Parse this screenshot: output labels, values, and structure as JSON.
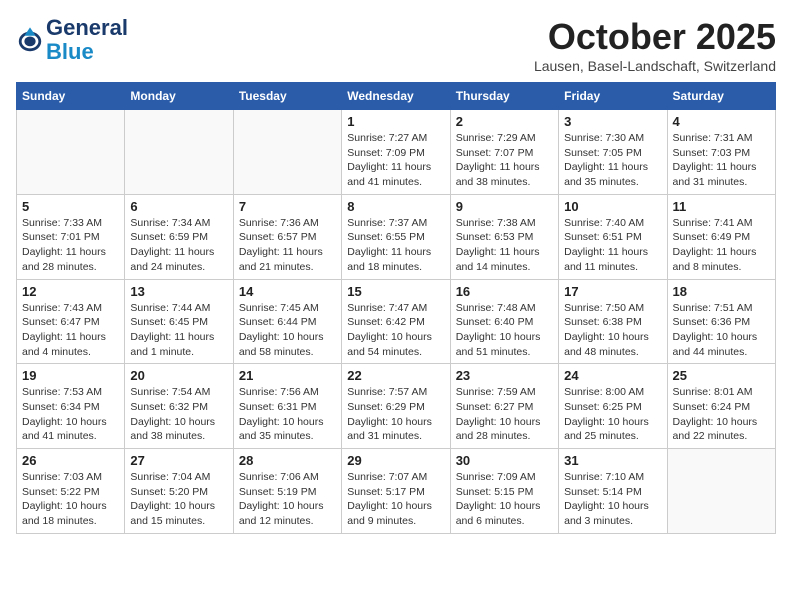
{
  "header": {
    "logo_line1": "General",
    "logo_line2": "Blue",
    "month": "October 2025",
    "location": "Lausen, Basel-Landschaft, Switzerland"
  },
  "weekdays": [
    "Sunday",
    "Monday",
    "Tuesday",
    "Wednesday",
    "Thursday",
    "Friday",
    "Saturday"
  ],
  "weeks": [
    [
      {
        "day": "",
        "info": ""
      },
      {
        "day": "",
        "info": ""
      },
      {
        "day": "",
        "info": ""
      },
      {
        "day": "1",
        "info": "Sunrise: 7:27 AM\nSunset: 7:09 PM\nDaylight: 11 hours and 41 minutes."
      },
      {
        "day": "2",
        "info": "Sunrise: 7:29 AM\nSunset: 7:07 PM\nDaylight: 11 hours and 38 minutes."
      },
      {
        "day": "3",
        "info": "Sunrise: 7:30 AM\nSunset: 7:05 PM\nDaylight: 11 hours and 35 minutes."
      },
      {
        "day": "4",
        "info": "Sunrise: 7:31 AM\nSunset: 7:03 PM\nDaylight: 11 hours and 31 minutes."
      }
    ],
    [
      {
        "day": "5",
        "info": "Sunrise: 7:33 AM\nSunset: 7:01 PM\nDaylight: 11 hours and 28 minutes."
      },
      {
        "day": "6",
        "info": "Sunrise: 7:34 AM\nSunset: 6:59 PM\nDaylight: 11 hours and 24 minutes."
      },
      {
        "day": "7",
        "info": "Sunrise: 7:36 AM\nSunset: 6:57 PM\nDaylight: 11 hours and 21 minutes."
      },
      {
        "day": "8",
        "info": "Sunrise: 7:37 AM\nSunset: 6:55 PM\nDaylight: 11 hours and 18 minutes."
      },
      {
        "day": "9",
        "info": "Sunrise: 7:38 AM\nSunset: 6:53 PM\nDaylight: 11 hours and 14 minutes."
      },
      {
        "day": "10",
        "info": "Sunrise: 7:40 AM\nSunset: 6:51 PM\nDaylight: 11 hours and 11 minutes."
      },
      {
        "day": "11",
        "info": "Sunrise: 7:41 AM\nSunset: 6:49 PM\nDaylight: 11 hours and 8 minutes."
      }
    ],
    [
      {
        "day": "12",
        "info": "Sunrise: 7:43 AM\nSunset: 6:47 PM\nDaylight: 11 hours and 4 minutes."
      },
      {
        "day": "13",
        "info": "Sunrise: 7:44 AM\nSunset: 6:45 PM\nDaylight: 11 hours and 1 minute."
      },
      {
        "day": "14",
        "info": "Sunrise: 7:45 AM\nSunset: 6:44 PM\nDaylight: 10 hours and 58 minutes."
      },
      {
        "day": "15",
        "info": "Sunrise: 7:47 AM\nSunset: 6:42 PM\nDaylight: 10 hours and 54 minutes."
      },
      {
        "day": "16",
        "info": "Sunrise: 7:48 AM\nSunset: 6:40 PM\nDaylight: 10 hours and 51 minutes."
      },
      {
        "day": "17",
        "info": "Sunrise: 7:50 AM\nSunset: 6:38 PM\nDaylight: 10 hours and 48 minutes."
      },
      {
        "day": "18",
        "info": "Sunrise: 7:51 AM\nSunset: 6:36 PM\nDaylight: 10 hours and 44 minutes."
      }
    ],
    [
      {
        "day": "19",
        "info": "Sunrise: 7:53 AM\nSunset: 6:34 PM\nDaylight: 10 hours and 41 minutes."
      },
      {
        "day": "20",
        "info": "Sunrise: 7:54 AM\nSunset: 6:32 PM\nDaylight: 10 hours and 38 minutes."
      },
      {
        "day": "21",
        "info": "Sunrise: 7:56 AM\nSunset: 6:31 PM\nDaylight: 10 hours and 35 minutes."
      },
      {
        "day": "22",
        "info": "Sunrise: 7:57 AM\nSunset: 6:29 PM\nDaylight: 10 hours and 31 minutes."
      },
      {
        "day": "23",
        "info": "Sunrise: 7:59 AM\nSunset: 6:27 PM\nDaylight: 10 hours and 28 minutes."
      },
      {
        "day": "24",
        "info": "Sunrise: 8:00 AM\nSunset: 6:25 PM\nDaylight: 10 hours and 25 minutes."
      },
      {
        "day": "25",
        "info": "Sunrise: 8:01 AM\nSunset: 6:24 PM\nDaylight: 10 hours and 22 minutes."
      }
    ],
    [
      {
        "day": "26",
        "info": "Sunrise: 7:03 AM\nSunset: 5:22 PM\nDaylight: 10 hours and 18 minutes."
      },
      {
        "day": "27",
        "info": "Sunrise: 7:04 AM\nSunset: 5:20 PM\nDaylight: 10 hours and 15 minutes."
      },
      {
        "day": "28",
        "info": "Sunrise: 7:06 AM\nSunset: 5:19 PM\nDaylight: 10 hours and 12 minutes."
      },
      {
        "day": "29",
        "info": "Sunrise: 7:07 AM\nSunset: 5:17 PM\nDaylight: 10 hours and 9 minutes."
      },
      {
        "day": "30",
        "info": "Sunrise: 7:09 AM\nSunset: 5:15 PM\nDaylight: 10 hours and 6 minutes."
      },
      {
        "day": "31",
        "info": "Sunrise: 7:10 AM\nSunset: 5:14 PM\nDaylight: 10 hours and 3 minutes."
      },
      {
        "day": "",
        "info": ""
      }
    ]
  ]
}
